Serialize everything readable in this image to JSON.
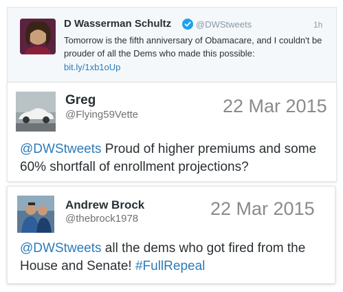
{
  "original_tweet": {
    "name": "D Wasserman Schultz",
    "verified_icon": "verified-badge-icon",
    "handle": "@DWStweets",
    "time": "1h",
    "text": "Tomorrow is the fifth anniversary of Obamacare, and I couldn't be prouder of all the Dems who made this possible:",
    "link": "bit.ly/1xb1oUp",
    "avatar": "profile-photo"
  },
  "reply_1": {
    "name": "Greg",
    "handle": "@Flying59Vette",
    "date": "22 Mar 2015",
    "mention": "@DWStweets",
    "text": " Proud of higher premiums and some 60% shortfall of enrollment projections?",
    "avatar": "car-photo"
  },
  "reply_2": {
    "name": "Andrew Brock",
    "handle": "@thebrock1978",
    "date": "22 Mar 2015",
    "mention": "@DWStweets",
    "text": " all the dems who got fired from the House and Senate! ",
    "hashtag": "#FullRepeal",
    "avatar": "profile-photo"
  },
  "colors": {
    "link": "#2b7bb9",
    "verified": "#1da1f2",
    "text": "#292f33"
  }
}
